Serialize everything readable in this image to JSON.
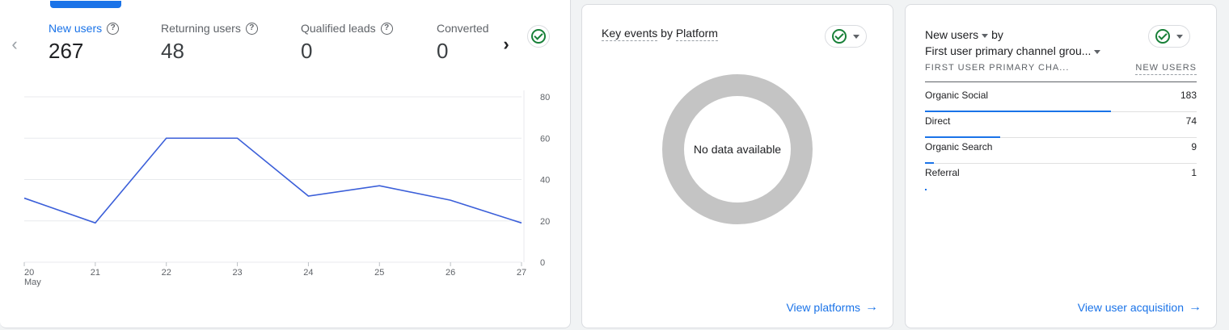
{
  "metrics_card": {
    "metrics": [
      {
        "label": "New users",
        "value": "267",
        "active": true
      },
      {
        "label": "Returning users",
        "value": "48",
        "active": false
      },
      {
        "label": "Qualified leads",
        "value": "0",
        "active": false
      },
      {
        "label": "Converted",
        "value": "0",
        "active": false
      }
    ],
    "prev_icon": "chevron-left-icon",
    "next_icon": "chevron-right-icon",
    "status_icon": "check-circle-icon"
  },
  "chart_data": {
    "type": "line",
    "categories": [
      "20",
      "21",
      "22",
      "23",
      "24",
      "25",
      "26",
      "27"
    ],
    "x_sub_label": "May",
    "series": [
      {
        "values": [
          31,
          19,
          60,
          60,
          32,
          37,
          30,
          19
        ]
      }
    ],
    "y_ticks": [
      "80",
      "60",
      "40",
      "20",
      "0"
    ],
    "ylim": [
      0,
      80
    ],
    "y_axis_side": "right",
    "grid": true,
    "line_color": "#3b5fd9"
  },
  "platform_card": {
    "title_part1": "Key events",
    "title_by": "by",
    "title_part2": "Platform",
    "empty_text": "No data available",
    "link_label": "View platforms"
  },
  "acquisition_card": {
    "title_metric": "New users",
    "title_by": "by",
    "title_dimension": "First user primary channel grou...",
    "col1": "FIRST USER PRIMARY CHA...",
    "col2": "NEW USERS",
    "rows": [
      {
        "name": "Organic Social",
        "value": "183",
        "share": 183
      },
      {
        "name": "Direct",
        "value": "74",
        "share": 74
      },
      {
        "name": "Organic Search",
        "value": "9",
        "share": 9
      },
      {
        "name": "Referral",
        "value": "1",
        "share": 1
      }
    ],
    "link_label": "View user acquisition"
  },
  "colors": {
    "accent": "#1a73e8",
    "check": "#188038",
    "donut_empty": "#c4c4c4"
  }
}
